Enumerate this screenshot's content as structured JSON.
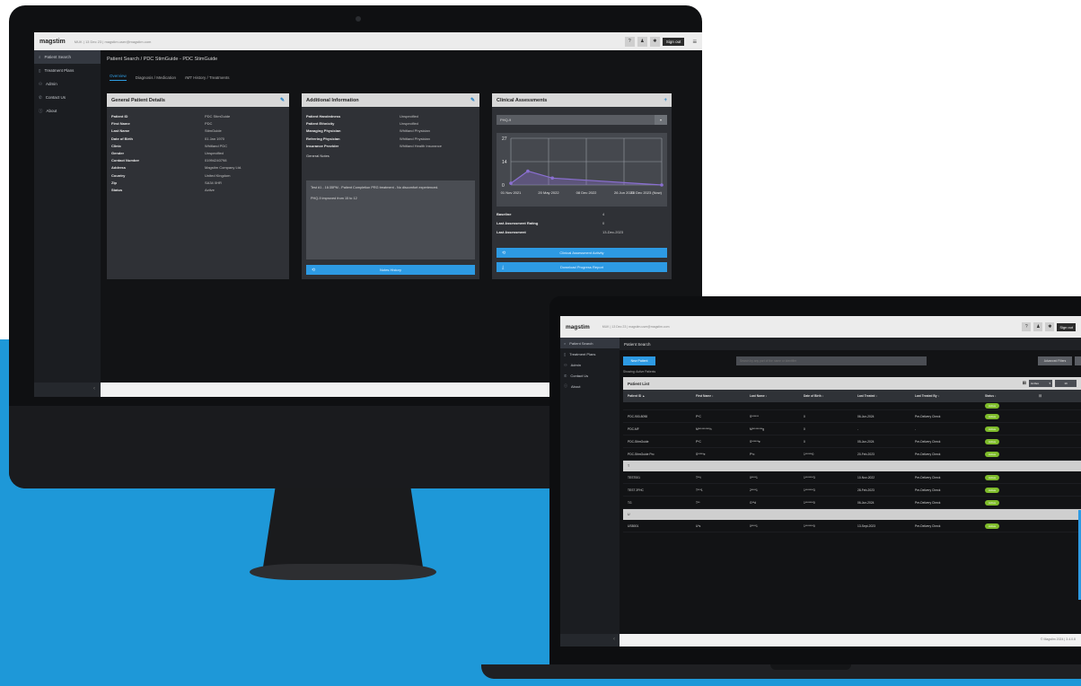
{
  "brand": "magstim",
  "topbar": {
    "email_desktop": "MUK | 13 Dec 23 | magstim.user@magstim.com",
    "email_laptop": "MUK | 13 Dec 23 | magstim.user@magstim.com",
    "help_icon": "question-icon",
    "user_icon": "user-icon",
    "settings_icon": "gear-icon",
    "signout": "Sign out",
    "menu_icon": "hamburger-menu-icon"
  },
  "sidebar": {
    "items": [
      {
        "icon": "search-icon",
        "label": "Patient Search"
      },
      {
        "icon": "document-icon",
        "label": "Treatment Plans"
      },
      {
        "icon": "admin-icon",
        "label": "Admin"
      },
      {
        "icon": "phone-icon",
        "label": "Contact Us"
      },
      {
        "icon": "info-icon",
        "label": "About"
      }
    ],
    "collapse": "‹"
  },
  "desktop": {
    "breadcrumb": "Patient Search  /  PDC StimGuide - PDC StimGuide",
    "tabs": [
      "Overview",
      "Diagnosis / Medication",
      "rMT History / Treatments"
    ],
    "general": {
      "title": "General Patient Details",
      "edit_icon": "edit-icon",
      "fields": [
        {
          "k": "Patient ID",
          "v": "PDC StimGuide"
        },
        {
          "k": "First Name",
          "v": "PDC"
        },
        {
          "k": "Last Name",
          "v": "StimGuide"
        },
        {
          "k": "Date of Birth",
          "v": "01 Jan 1970"
        },
        {
          "k": "Clinic",
          "v": "Whitland PDC"
        },
        {
          "k": "Gender",
          "v": "Unspecified"
        },
        {
          "k": "Contact Number",
          "v": "01994240798"
        },
        {
          "k": "Address",
          "v": "Magstim Company Ltd."
        },
        {
          "k": "Country",
          "v": "United Kingdom"
        },
        {
          "k": "Zip",
          "v": "SA34 0HR"
        },
        {
          "k": "Status",
          "v": "Active"
        }
      ]
    },
    "additional": {
      "title": "Additional Information",
      "edit_icon": "edit-icon",
      "fields": [
        {
          "k": "Patient Handedness",
          "v": "Unspecified"
        },
        {
          "k": "Patient Ethnicity",
          "v": "Unspecified"
        },
        {
          "k": "Managing Physician",
          "v": "Whitland Physician"
        },
        {
          "k": "Referring Physician",
          "v": "Whitland Physician"
        },
        {
          "k": "Insurance Provider",
          "v": "Whitland Health Insurance"
        }
      ],
      "notes_label": "General Notes",
      "note_1": "Test #1 - 16:35PM - Patient Completion PRG treatment - No discomfort experienced.",
      "note_2": "PHQ-9 improved from 15 to 12",
      "button": "Notes History"
    },
    "clinical": {
      "title": "Clinical Assessments",
      "add_icon": "plus-icon",
      "selector": "PHQ-9",
      "rows": [
        {
          "k": "Baseline",
          "v": "4"
        },
        {
          "k": "Last Assessment Rating",
          "v": "0"
        },
        {
          "k": "Last Assessment",
          "v": "13-Dec-2023"
        }
      ],
      "btn_history": "Clinical Assessment Activity",
      "btn_report": "Download Progress Report"
    }
  },
  "chart_data": {
    "type": "line",
    "x": [
      "01 Nov 2021",
      "20 May 2022",
      "08 Dec 2022",
      "26 Jun 2023",
      "13 Dec 2023 (Now)"
    ],
    "y_ticks": [
      "27",
      "14",
      "0"
    ],
    "ylim": [
      0,
      27
    ],
    "series": [
      {
        "points": [
          {
            "x": 0,
            "y": 1
          },
          {
            "x": 0.45,
            "y": 8
          },
          {
            "x": 1.1,
            "y": 4
          },
          {
            "x": 4.0,
            "y": 0
          }
        ]
      }
    ],
    "color": "#8a6fd1",
    "grid": true
  },
  "laptop": {
    "breadcrumb": "Patient Search",
    "new_patient": "New Patient",
    "search_placeholder": "Search by any part of the name or identifier",
    "advanced_filters": "Advanced Filters",
    "showing": "Showing: Active Patients",
    "list_title": "Patient List",
    "status_select": "Active",
    "page_select": "10",
    "columns": [
      "Patient ID ▲",
      "First Name ↕",
      "Last Name ↕",
      "Date of Birth ↕",
      "Last Treated ↕",
      "Last Treated By ↕",
      "Status ↕"
    ],
    "rows": [
      {
        "type": "partial",
        "id": "",
        "first": "",
        "last": "",
        "dob": "",
        "treated": "",
        "by": "",
        "status": "Active"
      },
      {
        "type": "row",
        "id": "PDC-900-8098",
        "first": "P*C",
        "last": "S******",
        "dob": "0",
        "treated": "06-Jun-2024",
        "by": "Pre-Delivery Check",
        "status": "Active"
      },
      {
        "type": "row",
        "id": "PDC-MF",
        "first": "M**********h",
        "last": "M*********g",
        "dob": "0",
        "treated": "-",
        "by": "-",
        "status": "Active"
      },
      {
        "type": "row",
        "id": "PDC-StimGuide",
        "first": "P*C",
        "last": "S******e",
        "dob": "0",
        "treated": "05-Jun-2024",
        "by": "Pre-Delivery Check",
        "status": "Active"
      },
      {
        "type": "row",
        "id": "PDC-StimGuide Pro",
        "first": "S*****e",
        "last": "P*o",
        "dob": "1******0",
        "treated": "20-Feb-2023",
        "by": "Pre-Delivery Check",
        "status": "Active"
      },
      {
        "type": "group",
        "label": "T"
      },
      {
        "type": "row",
        "id": "TEST001",
        "first": "T**t",
        "last": "0****1",
        "dob": "1*******3",
        "treated": "10-Nov-2022",
        "by": "Pre-Delivery Check",
        "status": "Active"
      },
      {
        "type": "row",
        "id": "TEST 2FHC",
        "first": "T***1",
        "last": "2****1",
        "dob": "1*******3",
        "treated": "28-Feb-2023",
        "by": "Pre-Delivery Check",
        "status": "Active"
      },
      {
        "type": "row",
        "id": "TG",
        "first": "T**",
        "last": "G**d",
        "dob": "1*******0",
        "treated": "06-Jun-2024",
        "by": "Pre-Delivery Check",
        "status": "Active"
      },
      {
        "type": "group",
        "label": "U"
      },
      {
        "type": "row",
        "id": "USB001",
        "first": "U*s",
        "last": "0****1",
        "dob": "1*******0",
        "treated": "13-Sept-2023",
        "by": "Pre-Delivery Check",
        "status": "Active"
      }
    ],
    "footer": "© Magstim 2024 | 3.4.0.8"
  }
}
